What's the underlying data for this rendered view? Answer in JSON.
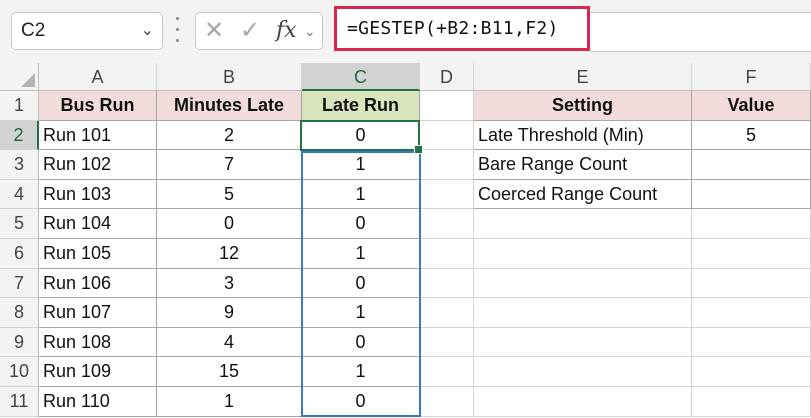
{
  "formula_bar": {
    "name_box": "C2",
    "formula": "=GESTEP(+B2:B11,F2)",
    "icons": [
      "chevron-down-icon",
      "cancel-x-icon",
      "confirm-check-icon",
      "fx-icon",
      "chevron-down-icon"
    ]
  },
  "columns": [
    "A",
    "B",
    "C",
    "D",
    "E",
    "F"
  ],
  "rows": [
    "1",
    "2",
    "3",
    "4",
    "5",
    "6",
    "7",
    "8",
    "9",
    "10",
    "11"
  ],
  "table": {
    "headers": [
      "Bus Run",
      "Minutes Late",
      "Late Run"
    ],
    "data": [
      [
        "Run 101",
        "2",
        "0"
      ],
      [
        "Run 102",
        "7",
        "1"
      ],
      [
        "Run 103",
        "5",
        "1"
      ],
      [
        "Run 104",
        "0",
        "0"
      ],
      [
        "Run 105",
        "12",
        "1"
      ],
      [
        "Run 106",
        "3",
        "0"
      ],
      [
        "Run 107",
        "9",
        "1"
      ],
      [
        "Run 108",
        "4",
        "0"
      ],
      [
        "Run 109",
        "15",
        "1"
      ],
      [
        "Run 110",
        "1",
        "0"
      ]
    ]
  },
  "settings": {
    "headers": [
      "Setting",
      "Value"
    ],
    "rows": [
      [
        "Late Threshold (Min)",
        "5"
      ],
      [
        "Bare Range Count",
        ""
      ],
      [
        "Coerced Range Count",
        ""
      ]
    ]
  },
  "colors": {
    "header_pink": "#f2dcdb",
    "header_green": "#d8e4bc",
    "formula_border": "#d8284f",
    "active_cell": "#217346",
    "range_highlight": "#3c78c8"
  }
}
